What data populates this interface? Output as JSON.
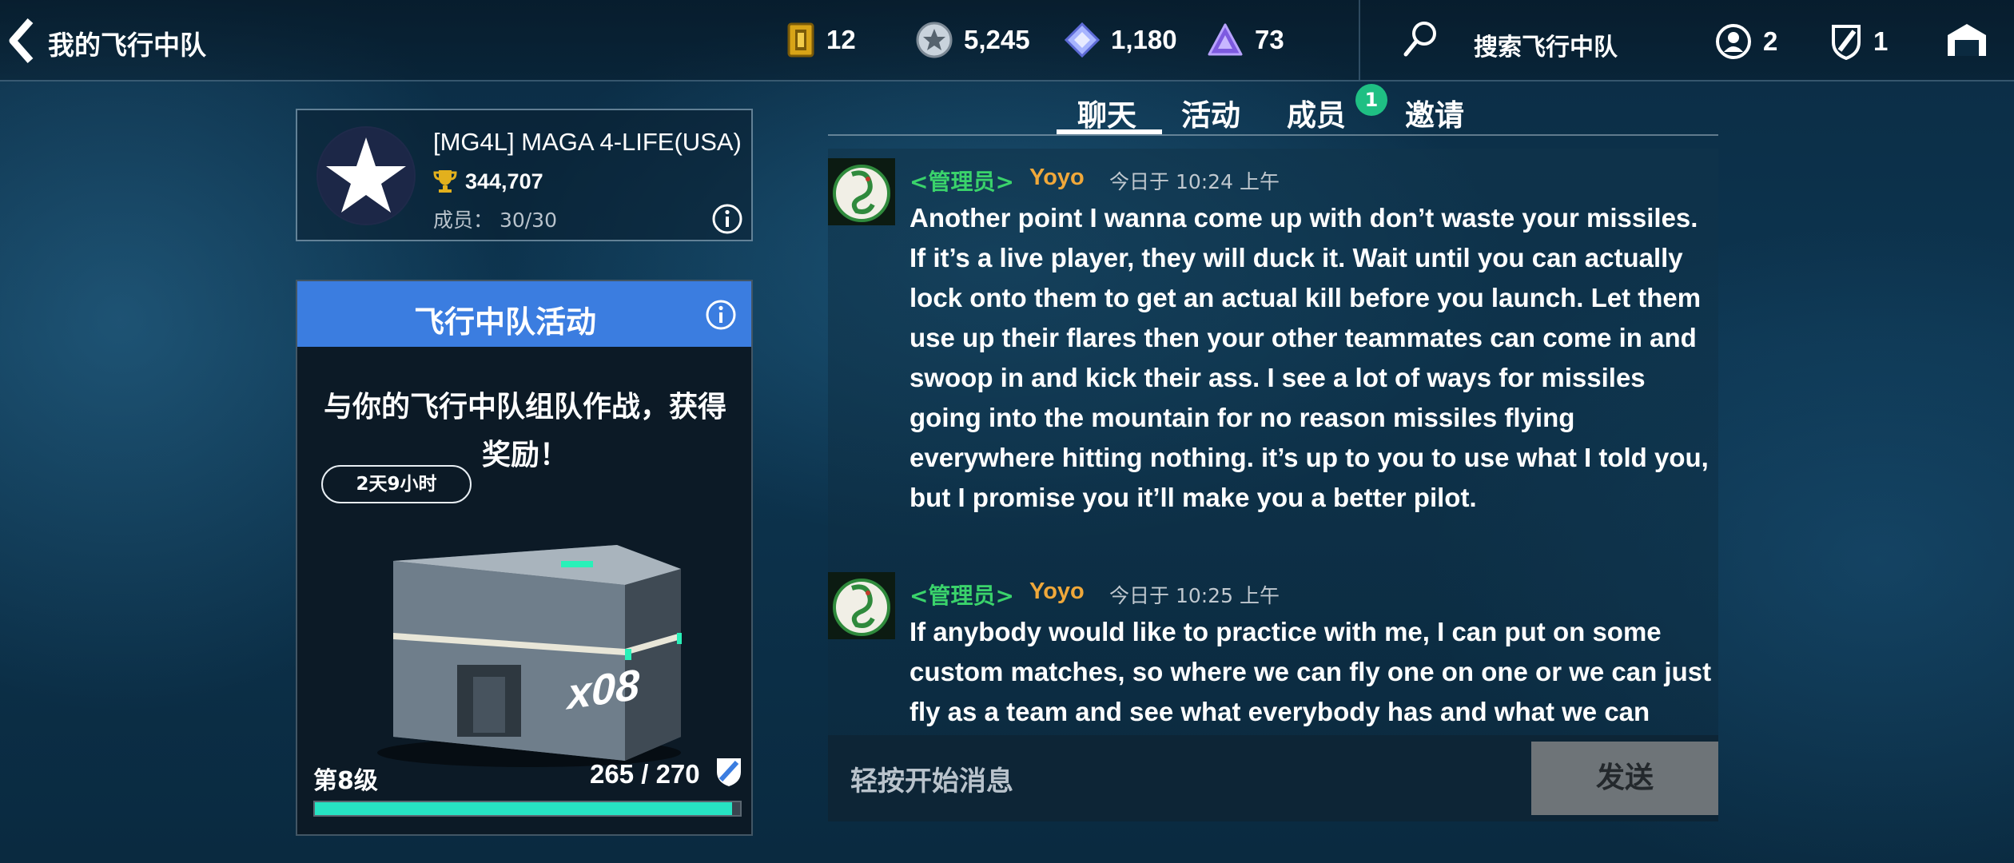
{
  "topbar": {
    "back_title": "我的飞行中队",
    "currencies": [
      {
        "icon": "ticket-icon",
        "value": "12"
      },
      {
        "icon": "silver-star-coin-icon",
        "value": "5,245"
      },
      {
        "icon": "diamond-gem-icon",
        "value": "1,180"
      },
      {
        "icon": "purple-triangle-token-icon",
        "value": "73"
      }
    ],
    "search_label": "搜索飞行中队",
    "friends_count": "2",
    "squadron_count": "1"
  },
  "squadron": {
    "name": "[MG4L] MAGA 4-LIFE(USA)",
    "score": "344,707",
    "members": "成员： 30/30"
  },
  "activity": {
    "title": "飞行中队活动",
    "description": "与你的飞行中队组队作战，获得奖励！",
    "timer": "2天9小时",
    "crate_multiplier": "x08",
    "level": "第8级",
    "progress_text": "265 / 270",
    "progress_value": 265,
    "progress_max": 270
  },
  "tabs": {
    "items": [
      "聊天",
      "活动",
      "成员",
      "邀请"
    ],
    "active": "聊天",
    "members_badge": "1"
  },
  "chat": {
    "messages": [
      {
        "role": "<管理员>",
        "user": "Yoyo",
        "time": "今日于 10:24 上午",
        "text": "Another point I wanna come up with don’t waste your missiles. If it’s a live player, they will duck it. Wait until you can actually lock onto them to get an actual kill before you launch. Let them use up their flares then your other teammates can come in and swoop in and kick their ass. I see a lot of ways for missiles going into the mountain for no reason missiles flying everywhere hitting nothing. it’s up to you to use what I told you, but I promise you it’ll make you a better pilot."
      },
      {
        "role": "<管理员>",
        "user": "Yoyo",
        "time": "今日于 10:25 上午",
        "text": "If anybody would like to practice with me, I can put on some custom matches, so where we can fly one on one or we can just fly as a team and see what everybody has and what we can"
      }
    ]
  },
  "composer": {
    "placeholder": "轻按开始消息",
    "send_label": "发送"
  },
  "colors": {
    "activity_header": "#3b7de0",
    "progress_fill": "#27e3c3",
    "admin_role": "#3ad36b",
    "username": "#f0a83a",
    "badge": "#1fbf83"
  }
}
